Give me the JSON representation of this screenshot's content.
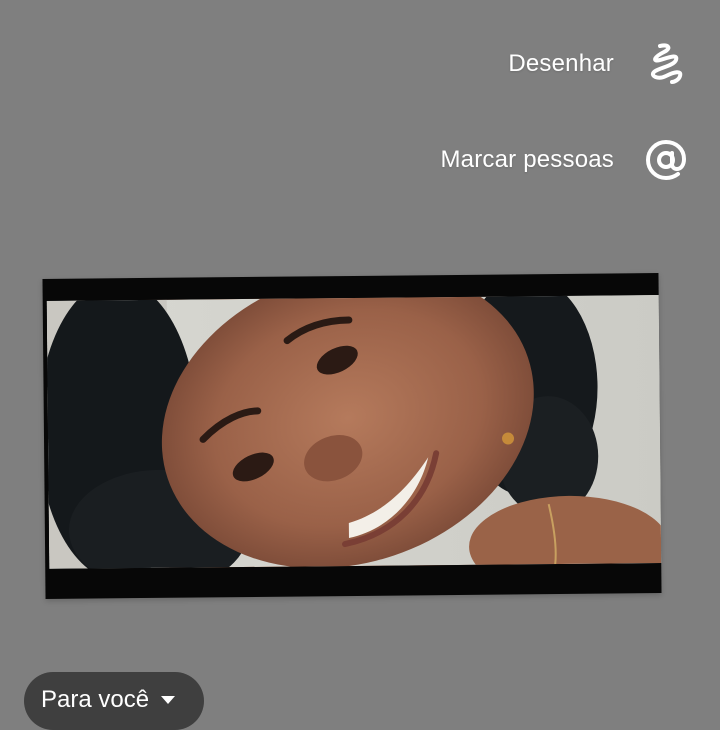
{
  "tools": {
    "draw": {
      "label": "Desenhar",
      "icon": "squiggle-icon"
    },
    "mention": {
      "label": "Marcar pessoas",
      "icon": "at-sign-icon"
    }
  },
  "photo": {
    "subject": "selfie of smiling woman with curly dark hair"
  },
  "audience": {
    "label": "Para você",
    "icon": "caret-down-icon"
  },
  "colors": {
    "background": "#7f7f7f",
    "pill": "#3f3f3f",
    "text": "#ffffff"
  }
}
